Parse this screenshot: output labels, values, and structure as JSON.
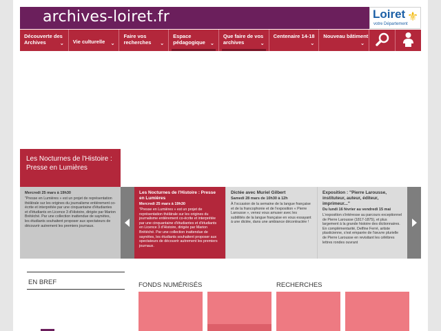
{
  "header": {
    "site_title": "archives-loiret.fr",
    "logo_text": "Loiret",
    "logo_sub": "votre Département",
    "logo_icon": "fleur-de-lis-icon"
  },
  "nav": {
    "items": [
      {
        "label": "Découverte des Archives",
        "width": 72
      },
      {
        "label": "Vie culturelle",
        "width": 75
      },
      {
        "label": "Faire vos recherches",
        "width": 73
      },
      {
        "label": "Espace pédagogique",
        "width": 74
      },
      {
        "label": "Que faire de vos archives",
        "width": 74
      },
      {
        "label": "Centenaire 14-18",
        "width": 74
      },
      {
        "label": "Nouveau bâtiment",
        "width": 74
      }
    ]
  },
  "feature": {
    "title": "Les Nocturnes de l'Histoire : Presse en Lumières"
  },
  "carousel": {
    "lead": {
      "date": "Mercredi 25 mars à 19h30",
      "desc": "\"Presse en Lumières » est un projet de représentation théâtrale sur les origines du journalisme entièrement co-écrite et interprétée par une cinquantaine d'étudiantes et d'étudiants en Licence 3 d'Histoire, dirigée par Marion Brétéché. Par une collection inattendue de saynètes, les étudiants souhaitent proposer aux spectateurs de découvrir autrement les premiers journaux."
    },
    "cards": [
      {
        "title": "Les Nocturnes de l'Histoire : Presse en Lumières",
        "date": "Mercredi 25 mars à 19h30",
        "desc": "\"Presse en Lumières » est un projet de représentation théâtrale sur les origines du journalisme entièrement co-écrite et interprétée par une cinquantaine d'étudiantes et d'étudiants en Licence 3 d'Histoire, dirigée par Marion Brétéché. Par une collection inattendue de saynètes, les étudiants souhaitent proposer aux spectateurs de découvrir autrement les premiers journaux."
      },
      {
        "title": "Dictée avec Muriel Gilbert",
        "date": "Samedi 28 mars de 10h30 à 12h",
        "desc": "À l'occasion de la semaine de la langue française et de la francophonie et de l'exposition « Pierre Larousse », venez vous amuser avec les subtilités de la langue française en vous essayant à une dictée, dans une ambiance décontractée !"
      },
      {
        "title": "Exposition : \"Pierre Larousse, instituteur, auteur, éditeur, imprimeur...\"",
        "date": "Du lundi 16 février au vendredi 15 mai",
        "desc": "L'exposition s'intéresse au parcours exceptionnel de Pierre Larousse (1817-1875), et plus largement à la grande histoire des dictionnaires. En complémentarité, Delfine Ferré, artiste plasticienne, s'est emparée de l'œuvre plurielle de Pierre Larousse en revisitant les célèbres lettres rondes ouvrant"
      }
    ]
  },
  "sections": {
    "bref": "EN BREF",
    "fonds": "FONDS NUMÉRISÉS",
    "recherches": "RECHERCHES"
  },
  "colors": {
    "header_bg": "#6b1f5c",
    "nav_bg": "#b3273b",
    "tile_bg": "#ee7a82",
    "carousel_bg": "#dcdcdc"
  }
}
